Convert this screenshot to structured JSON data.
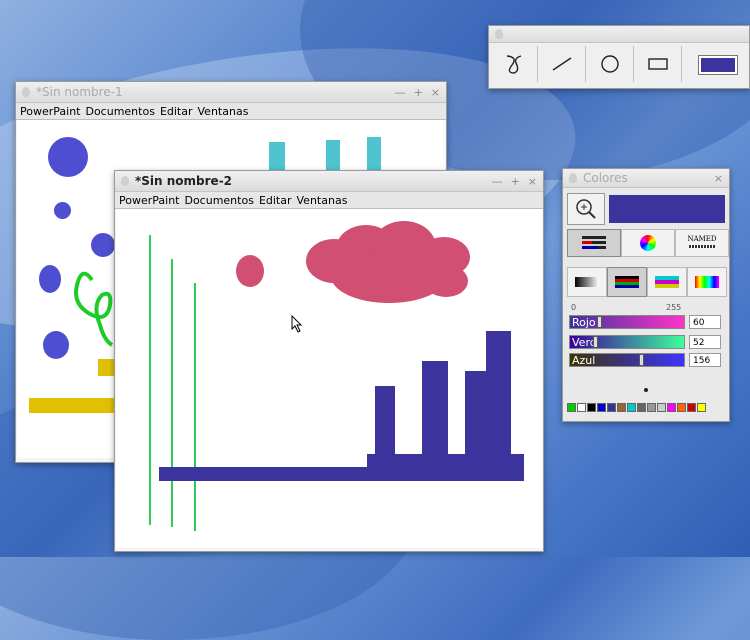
{
  "window1": {
    "title": "*Sin nombre-1",
    "controls": [
      "—",
      "+",
      "×"
    ]
  },
  "window2": {
    "title": "*Sin nombre-2",
    "controls": [
      "—",
      "+",
      "×"
    ]
  },
  "menu": [
    "PowerPaint",
    "Documentos",
    "Editar",
    "Ventanas"
  ],
  "colores": {
    "title": "Colores",
    "close": "×",
    "named_label": "NAMED",
    "range_min": "0",
    "range_max": "255",
    "sliders": [
      {
        "label": "Rojo",
        "value": "60",
        "level": 0.235
      },
      {
        "label": "Verd",
        "value": "52",
        "level": 0.204
      },
      {
        "label": "Azul",
        "value": "156",
        "level": 0.612
      }
    ],
    "current_color": "#3c349c",
    "palette": [
      "#00cc00",
      "#ffffff",
      "#000000",
      "#0000cc",
      "#333399",
      "#996633",
      "#00cccc",
      "#666666",
      "#999999",
      "#cccccc",
      "#ff00ff",
      "#ff6600",
      "#cc0000",
      "#ffff00"
    ]
  },
  "toolbar": {
    "tools": [
      "freehand-icon",
      "line-icon",
      "circle-icon",
      "rectangle-icon"
    ],
    "current_color": "#3c349c"
  }
}
